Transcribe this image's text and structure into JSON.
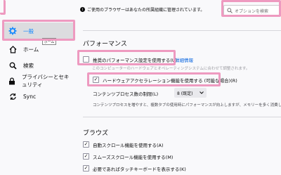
{
  "managed_notice": "ご使用のブラウザーはあなたの所属組織に管理されています。",
  "search": {
    "placeholder": "オプションを検索"
  },
  "sidebar": {
    "items": [
      {
        "label": "一般",
        "icon": "gear-icon"
      },
      {
        "label": "ホーム",
        "icon": "home-icon"
      },
      {
        "label": "検索",
        "icon": "search-icon"
      },
      {
        "label": "プライバシーとセキュリティ",
        "icon": "lock-icon"
      },
      {
        "label": "Sync",
        "icon": "sync-icon"
      }
    ],
    "tooltip": "ホーム"
  },
  "performance": {
    "title": "パフォーマンス",
    "recommended_label": "推奨のパフォーマンス設定を使用する(U)",
    "learn_more": "詳細情報",
    "recommended_desc": "このコンピューターのハードウェアとオペレーティングシステムに合わせて調整されます。",
    "hw_accel_label": "ハードウェアアクセラレーション機能を使用する (可能な場合)(R)",
    "process_limit_label": "コンテンツプロセス数の制限(L)",
    "process_limit_value": "8 (既定)",
    "process_desc": "コンテンツプロセスを増やすと、複数タブの使用時にパフォーマンスが向上しますが、メモリーを多く消費します。"
  },
  "browsing": {
    "title": "ブラウズ",
    "items": [
      {
        "label": "自動スクロール機能を使用する(A)",
        "checked": true
      },
      {
        "label": "スムーズスクロール機能を使用する(M)",
        "checked": true
      },
      {
        "label": "必要であればタッチキーボードを表示する(K)",
        "checked": true
      }
    ]
  },
  "colors": {
    "accent": "#0a84ff",
    "highlight": "#ee9ac0",
    "link": "#0060df"
  }
}
